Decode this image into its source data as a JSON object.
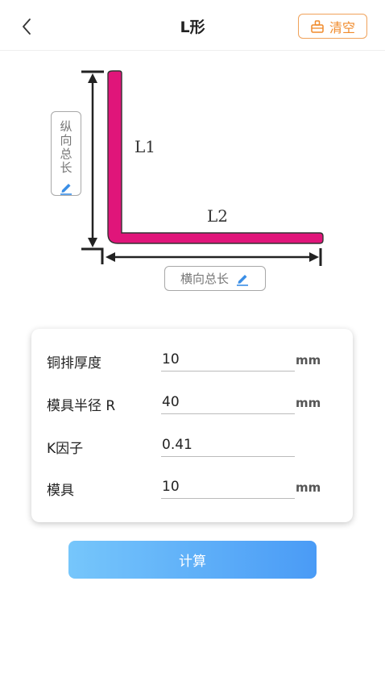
{
  "header": {
    "title": "L形",
    "clear_label": "清空"
  },
  "diagram": {
    "label_l1": "L1",
    "label_l2": "L2",
    "vertical_total_label": "纵向总长",
    "horizontal_total_label": "横向总长",
    "shape_color": "#e0157a"
  },
  "form": {
    "rows": [
      {
        "label": "铜排厚度",
        "value": "10",
        "unit": "mm"
      },
      {
        "label": "模具半径 R",
        "value": "40",
        "unit": "mm"
      },
      {
        "label": "K因子",
        "value": "0.41",
        "unit": ""
      },
      {
        "label": "模具",
        "value": "10",
        "unit": "mm"
      }
    ]
  },
  "calculate_label": "计算",
  "colors": {
    "accent_orange": "#f08a2a",
    "button_blue_start": "#76c6fb",
    "button_blue_end": "#4a9bf6",
    "pencil_blue": "#3a8ee6"
  }
}
